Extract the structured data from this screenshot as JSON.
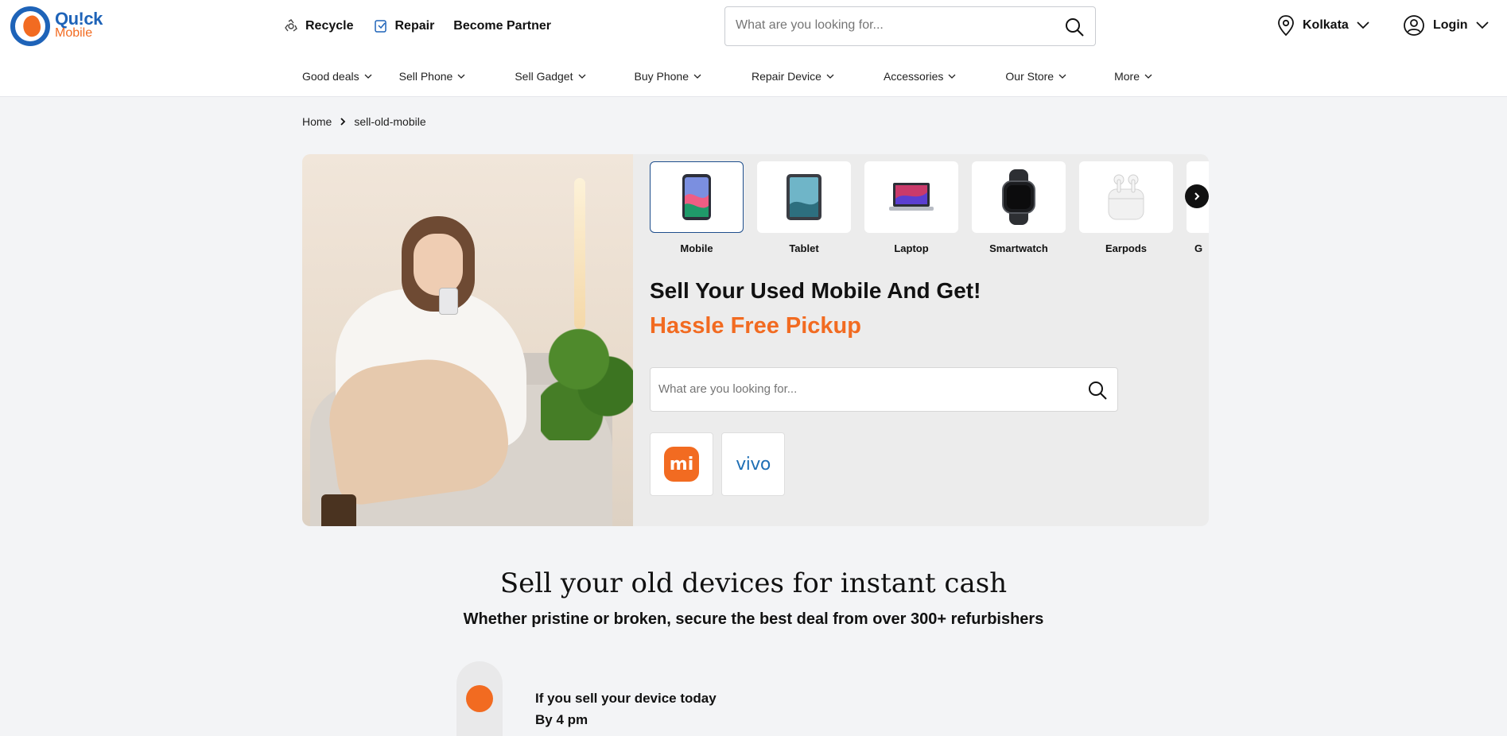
{
  "brand": {
    "line1": "Qu!ck",
    "line2": "Mobile"
  },
  "top_links": [
    {
      "label": "Recycle",
      "icon": "recycle-icon"
    },
    {
      "label": "Repair",
      "icon": "repair-icon"
    },
    {
      "label": "Become Partner"
    }
  ],
  "search": {
    "placeholder": "What are you looking for..."
  },
  "location": {
    "city": "Kolkata"
  },
  "login": {
    "label": "Login"
  },
  "nav": [
    "Good deals",
    "Sell Phone",
    "Sell Gadget",
    "Buy Phone",
    "Repair Device",
    "Accessories",
    "Our Store",
    "More"
  ],
  "breadcrumb": {
    "home": "Home",
    "current": "sell-old-mobile"
  },
  "categories": [
    {
      "label": "Mobile",
      "icon": "mobile-icon",
      "active": true
    },
    {
      "label": "Tablet",
      "icon": "tablet-icon"
    },
    {
      "label": "Laptop",
      "icon": "laptop-icon"
    },
    {
      "label": "Smartwatch",
      "icon": "smartwatch-icon"
    },
    {
      "label": "Earpods",
      "icon": "earpods-icon"
    },
    {
      "label": "G",
      "icon": "gadget-icon"
    }
  ],
  "hero": {
    "title": "Sell Your Used Mobile And Get!",
    "subtitle": "Hassle Free Pickup",
    "search_placeholder": "What are you looking for..."
  },
  "brands": [
    {
      "name": "mi",
      "logo_text": "mi"
    },
    {
      "name": "vivo",
      "logo_text": "vivo"
    }
  ],
  "section": {
    "title": "Sell your old devices for instant cash",
    "subtitle": "Whether pristine or broken, secure the best deal from over 300+ refurbishers"
  },
  "timeline": {
    "line1": "If you sell your device today",
    "line2": "By 4 pm"
  },
  "colors": {
    "accent": "#f26b21",
    "brand_blue": "#1e63b8",
    "background": "#f3f4f6"
  }
}
